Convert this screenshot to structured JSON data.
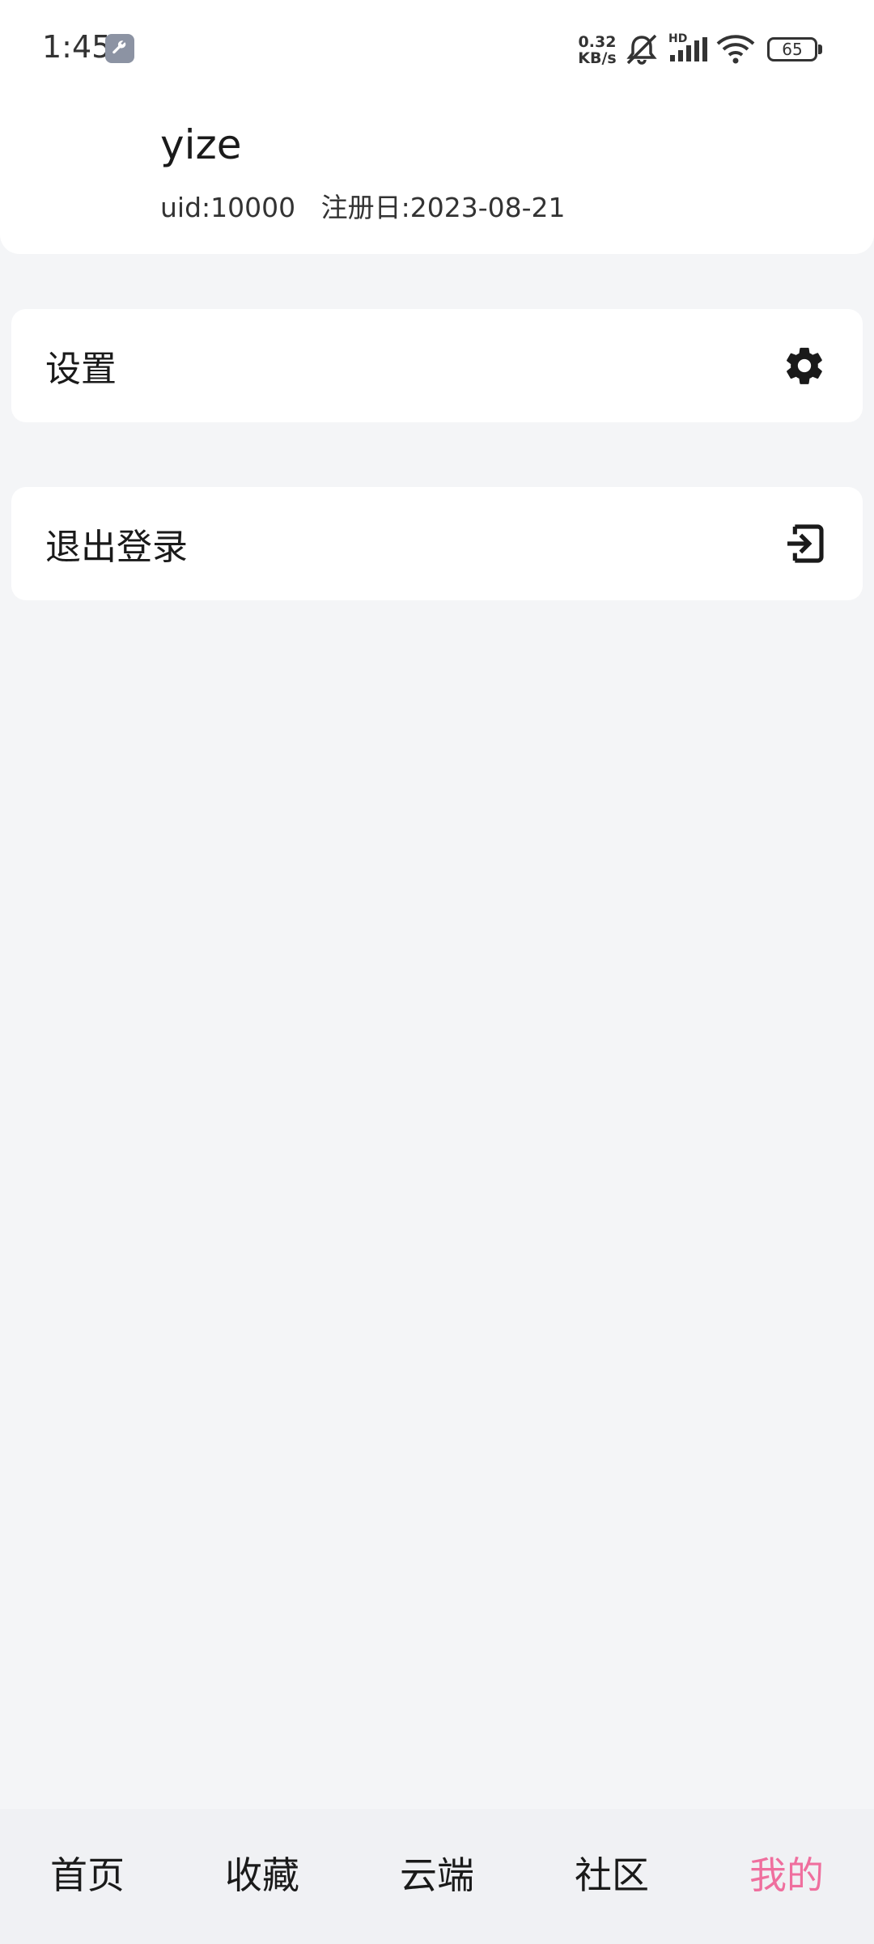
{
  "status_bar": {
    "time": "1:45",
    "net_speed_value": "0.32",
    "net_speed_unit": "KB/s",
    "signal_label": "HD",
    "battery": "65"
  },
  "profile": {
    "name": "yize",
    "uid_text": "uid:10000",
    "register_text": "注册日:2023-08-21"
  },
  "menu": {
    "settings_label": "设置",
    "settings_icon": "gear-icon",
    "logout_label": "退出登录",
    "logout_icon": "logout-icon"
  },
  "bottom_nav": {
    "items": [
      {
        "label": "首页"
      },
      {
        "label": "收藏"
      },
      {
        "label": "云端"
      },
      {
        "label": "社区"
      },
      {
        "label": "我的"
      }
    ],
    "active_index": 4,
    "active_color": "#ef6f9e"
  }
}
